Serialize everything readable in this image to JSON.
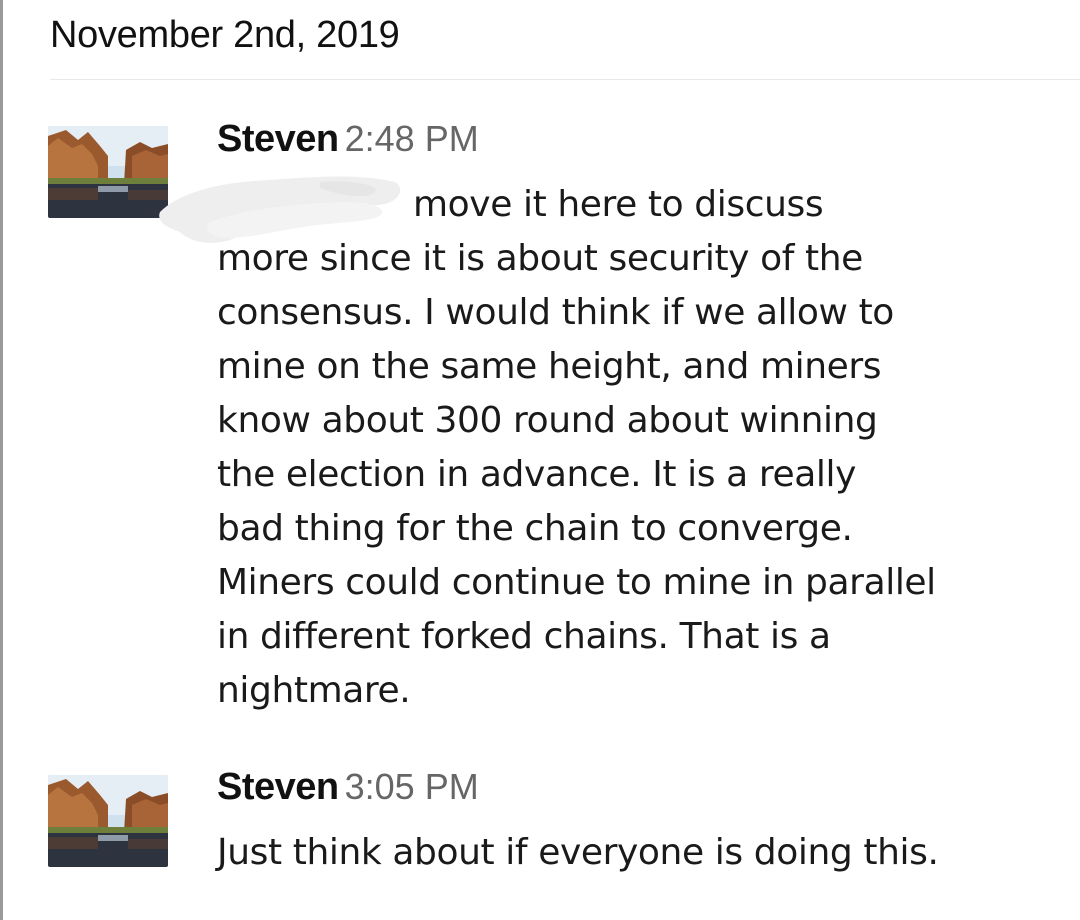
{
  "channel": {
    "date_divider": "November 2nd, 2019"
  },
  "messages": [
    {
      "sender": "Steven",
      "time": "2:48 PM",
      "avatar_icon": "landscape-lake-photo",
      "lines": [
        "move it here to discuss",
        "more since it is about security of the",
        "consensus. I would think if we allow to",
        "mine on the same height, and miners",
        "know about 300 round about winning",
        "the election in advance. It is a really",
        "bad thing for the chain to converge.",
        "Miners could continue to mine in parallel",
        "in different forked chains. That is a",
        "nightmare."
      ]
    },
    {
      "sender": "Steven",
      "time": "3:05 PM",
      "avatar_icon": "landscape-lake-photo",
      "lines": [
        "Just think about if everyone is doing this."
      ]
    }
  ],
  "colors": {
    "text": "#1a1a1a",
    "timestamp": "#666666",
    "divider": "#e8e8e8",
    "redaction": "#eeeeee"
  }
}
